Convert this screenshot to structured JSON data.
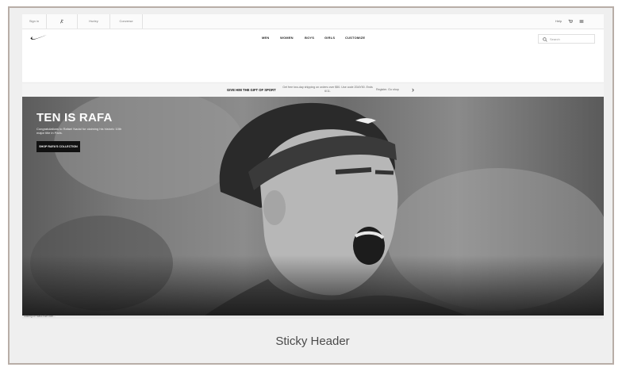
{
  "utility_bar": {
    "items": [
      "Sign in",
      "Jordan",
      "Hurley",
      "Converse"
    ],
    "right": [
      "Help",
      "Cart",
      "Menu"
    ]
  },
  "nav": {
    "menu": [
      "MEN",
      "WOMEN",
      "BOYS",
      "GIRLS",
      "CUSTOMIZE"
    ],
    "search_placeholder": "Search"
  },
  "promo": {
    "title": "GIVE HIM THE GIFT OF SPORT",
    "text": "Get free two-day shipping on orders over $50. Use code 2DAY50. Ends 6/11.",
    "link": "Register. Go shop"
  },
  "hero": {
    "title": "TEN IS RAFA",
    "subtitle": "Congratulations to Rafael Nadal for claiming his historic 10th major title in Paris.",
    "cta": "SHOP RAFA'S COLLECTION"
  },
  "status": {
    "text": "Waiting for static.nike.com..."
  },
  "caption": "Sticky Header",
  "colors": {
    "frame_border": "#b8aea7",
    "cta_bg": "#111111"
  }
}
